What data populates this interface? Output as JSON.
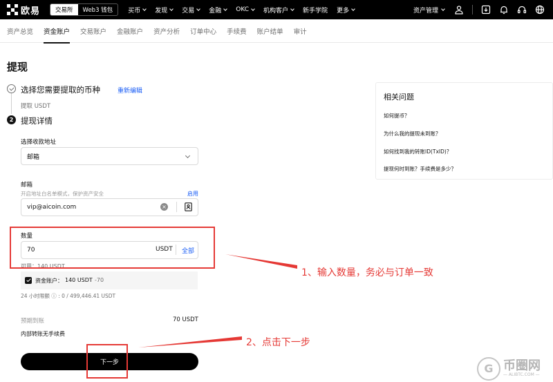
{
  "topbar": {
    "brand": "欧易",
    "switch_exchange": "交易所",
    "switch_wallet": "Web3 钱包",
    "nav": [
      {
        "label": "买币",
        "chevron": true
      },
      {
        "label": "发现",
        "chevron": true
      },
      {
        "label": "交易",
        "chevron": true
      },
      {
        "label": "金融",
        "chevron": true
      },
      {
        "label": "OKC",
        "chevron": true
      },
      {
        "label": "机构客户",
        "chevron": true
      },
      {
        "label": "新手学院",
        "chevron": false
      },
      {
        "label": "更多",
        "chevron": true
      }
    ],
    "asset_management": "资产管理"
  },
  "subtabs": [
    "资产总览",
    "资金账户",
    "交易账户",
    "金融账户",
    "资产分析",
    "订单中心",
    "手续费",
    "账户结单",
    "审计"
  ],
  "active_subtab": "资金账户",
  "page_title": "提现",
  "step1": {
    "title": "选择您需要提取的币种",
    "reedit": "重新编辑",
    "subtitle": "提取 USDT"
  },
  "step2": {
    "number": "2",
    "title": "提现详情"
  },
  "address": {
    "label": "选择收款地址",
    "value": "邮箱"
  },
  "email": {
    "label": "邮箱",
    "hint": "开启地址白名单模式，保护资产安全",
    "enable": "启用",
    "value": "vip@aicoin.com"
  },
  "amount": {
    "label": "数量",
    "value": "70",
    "unit": "USDT",
    "all": "全部",
    "available": "可用：140 USDT"
  },
  "account": {
    "label": "资金账户：",
    "value": "140 USDT",
    "minus": "-70"
  },
  "limit": "24 小时限额 ⓘ : 0 / 499,446.41 USDT",
  "expected": {
    "label": "预期到账",
    "value": "70 USDT"
  },
  "no_fee": "内部转账无手续费",
  "next_button": "下一步",
  "faq": {
    "title": "相关问题",
    "items": [
      "如何提币？",
      "为什么我的提现未到账？",
      "如何找到我的转账ID(TxID)？",
      "提现何时到账？手续费是多少？"
    ]
  },
  "annotations": {
    "note1": "1、输入数量，务必与订单一致",
    "note2": "2、点击下一步",
    "color": "#e53935"
  },
  "watermark": {
    "title": "币圈网",
    "url": "— ALIBTC.COM —"
  },
  "colors": {
    "link": "#1a5df5",
    "topbar": "#000000",
    "button": "#000000"
  }
}
